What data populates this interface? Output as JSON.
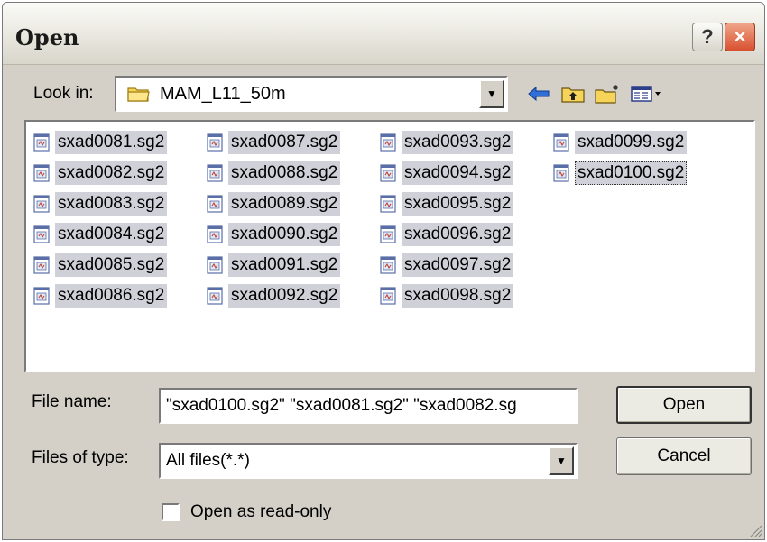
{
  "window": {
    "title": "Open"
  },
  "toolbar": {
    "look_in_label": "Look in:",
    "look_in_value": "MAM_L11_50m",
    "icons": [
      "back-arrow-icon",
      "up-folder-icon",
      "new-folder-icon",
      "view-menu-icon"
    ]
  },
  "files": [
    [
      "sxad0081.sg2",
      "sxad0082.sg2",
      "sxad0083.sg2",
      "sxad0084.sg2",
      "sxad0085.sg2",
      "sxad0086.sg2"
    ],
    [
      "sxad0087.sg2",
      "sxad0088.sg2",
      "sxad0089.sg2",
      "sxad0090.sg2",
      "sxad0091.sg2",
      "sxad0092.sg2"
    ],
    [
      "sxad0093.sg2",
      "sxad0094.sg2",
      "sxad0095.sg2",
      "sxad0096.sg2",
      "sxad0097.sg2",
      "sxad0098.sg2"
    ],
    [
      "sxad0099.sg2",
      "sxad0100.sg2"
    ]
  ],
  "focused_file": "sxad0100.sg2",
  "form": {
    "file_name_label": "File name:",
    "file_name_value": "\"sxad0100.sg2\" \"sxad0081.sg2\" \"sxad0082.sg",
    "file_type_label": "Files of type:",
    "file_type_value": "All files(*.*)",
    "readonly_label": "Open as read-only",
    "readonly_checked": false
  },
  "buttons": {
    "open": "Open",
    "cancel": "Cancel",
    "help": "?",
    "close": "×"
  },
  "colors": {
    "selection": "#cfd0d8",
    "dialog_bg": "#d4d0c8",
    "close_button": "#d8502f"
  }
}
